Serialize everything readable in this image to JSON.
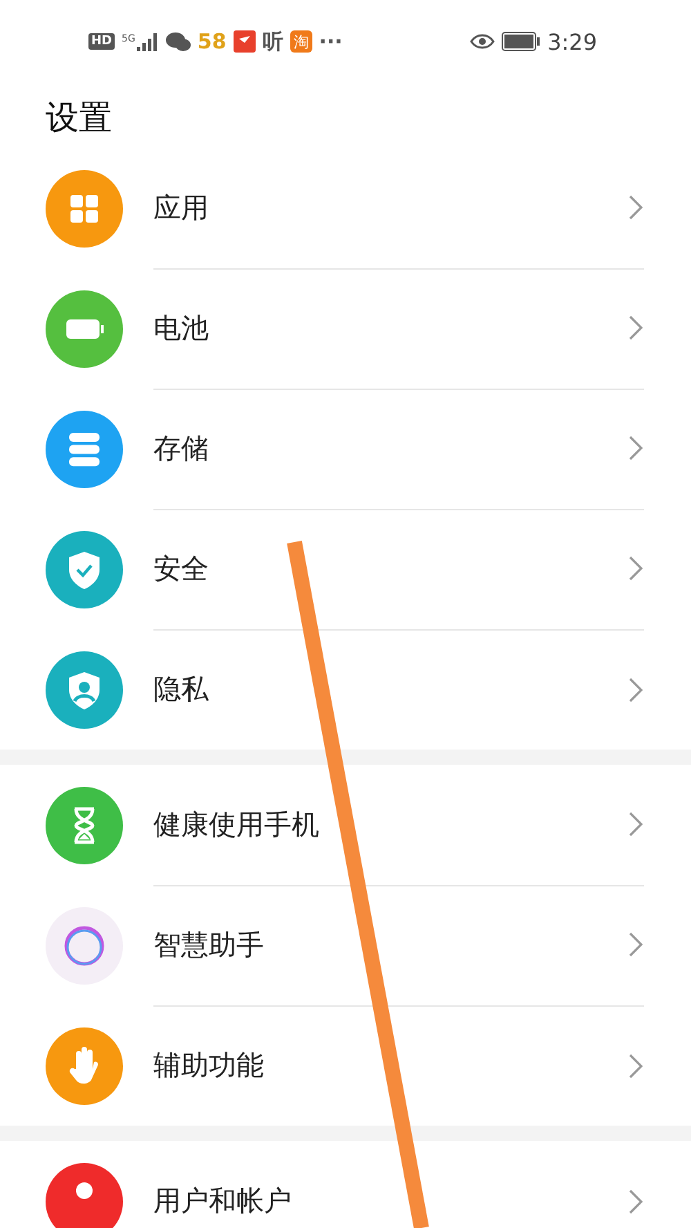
{
  "status_bar": {
    "left": [
      {
        "kind": "hd",
        "label": "HD"
      },
      {
        "kind": "signal",
        "label": "5G"
      },
      {
        "kind": "chat"
      },
      {
        "kind": "brand",
        "label": "58"
      },
      {
        "kind": "flag"
      },
      {
        "kind": "glyph",
        "label": "听"
      },
      {
        "kind": "tile",
        "label": "淘"
      },
      {
        "kind": "glyph",
        "label": "···"
      }
    ],
    "right": [
      {
        "kind": "eye"
      },
      {
        "kind": "battery"
      },
      {
        "kind": "time",
        "label": "3:29"
      }
    ]
  },
  "title": "设置",
  "groups": [
    {
      "items": [
        {
          "label": "应用",
          "kind": "apps",
          "color": "#f7980f"
        },
        {
          "label": "电池",
          "kind": "battery",
          "color": "#55bf3f"
        },
        {
          "label": "存储",
          "kind": "storage",
          "color": "#1ea3f2"
        },
        {
          "label": "安全",
          "kind": "shield-check",
          "color": "#1ab0bd"
        },
        {
          "label": "隐私",
          "kind": "shield-person",
          "color": "#1ab0bd"
        }
      ]
    },
    {
      "items": [
        {
          "label": "健康使用手机",
          "kind": "hourglass",
          "color": "#3fbe47"
        },
        {
          "label": "智慧助手",
          "kind": "ring",
          "color": "#f4eef6"
        },
        {
          "label": "辅助功能",
          "kind": "hand",
          "color": "#f7980f"
        }
      ]
    },
    {
      "items": [
        {
          "label": "用户和帐户",
          "kind": "person",
          "color": "#ef2b2b"
        }
      ]
    }
  ],
  "annotation": {
    "kind": "stroke",
    "color": "#f58a3c"
  }
}
